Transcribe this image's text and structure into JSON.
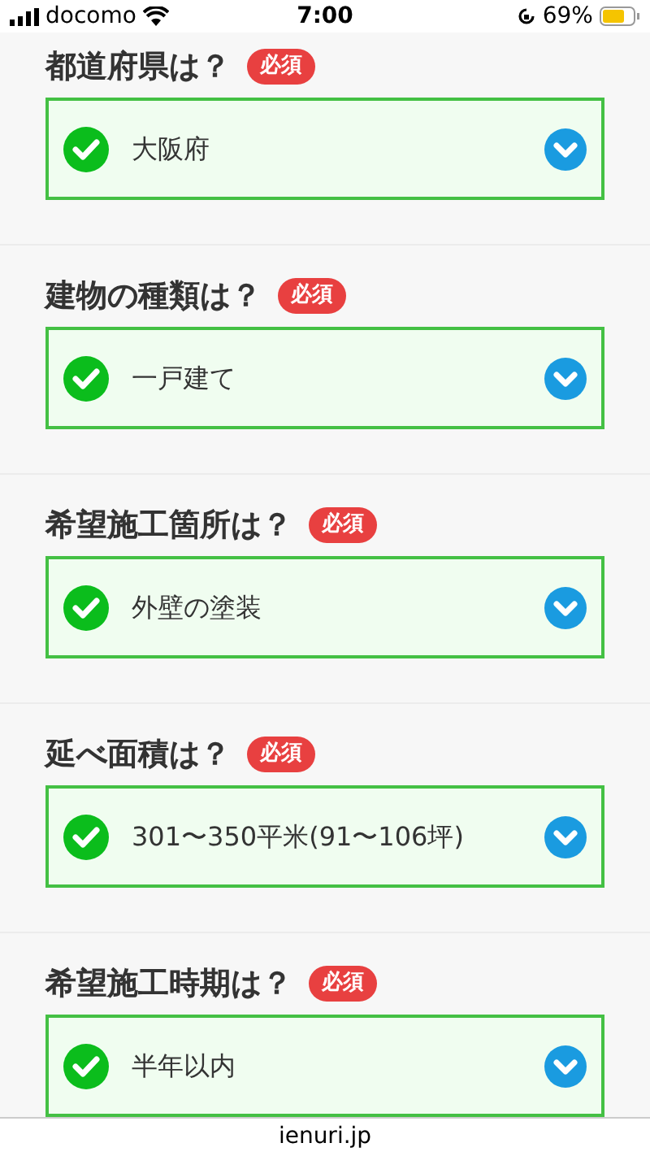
{
  "status_bar": {
    "carrier": "docomo",
    "time": "7:00",
    "battery": "69%"
  },
  "questions": [
    {
      "title": "都道府県は？",
      "badge": "必須",
      "value": "大阪府",
      "checked": true
    },
    {
      "title": "建物の種類は？",
      "badge": "必須",
      "value": "一戸建て",
      "checked": true
    },
    {
      "title": "希望施工箇所は？",
      "badge": "必須",
      "value": "外壁の塗装",
      "checked": true
    },
    {
      "title": "延べ面積は？",
      "badge": "必須",
      "value": "301〜350平米(91〜106坪)",
      "checked": true
    },
    {
      "title": "希望施工時期は？",
      "badge": "必須",
      "value": "半年以内",
      "checked": true
    }
  ],
  "footer": {
    "url": "ienuri.jp"
  }
}
